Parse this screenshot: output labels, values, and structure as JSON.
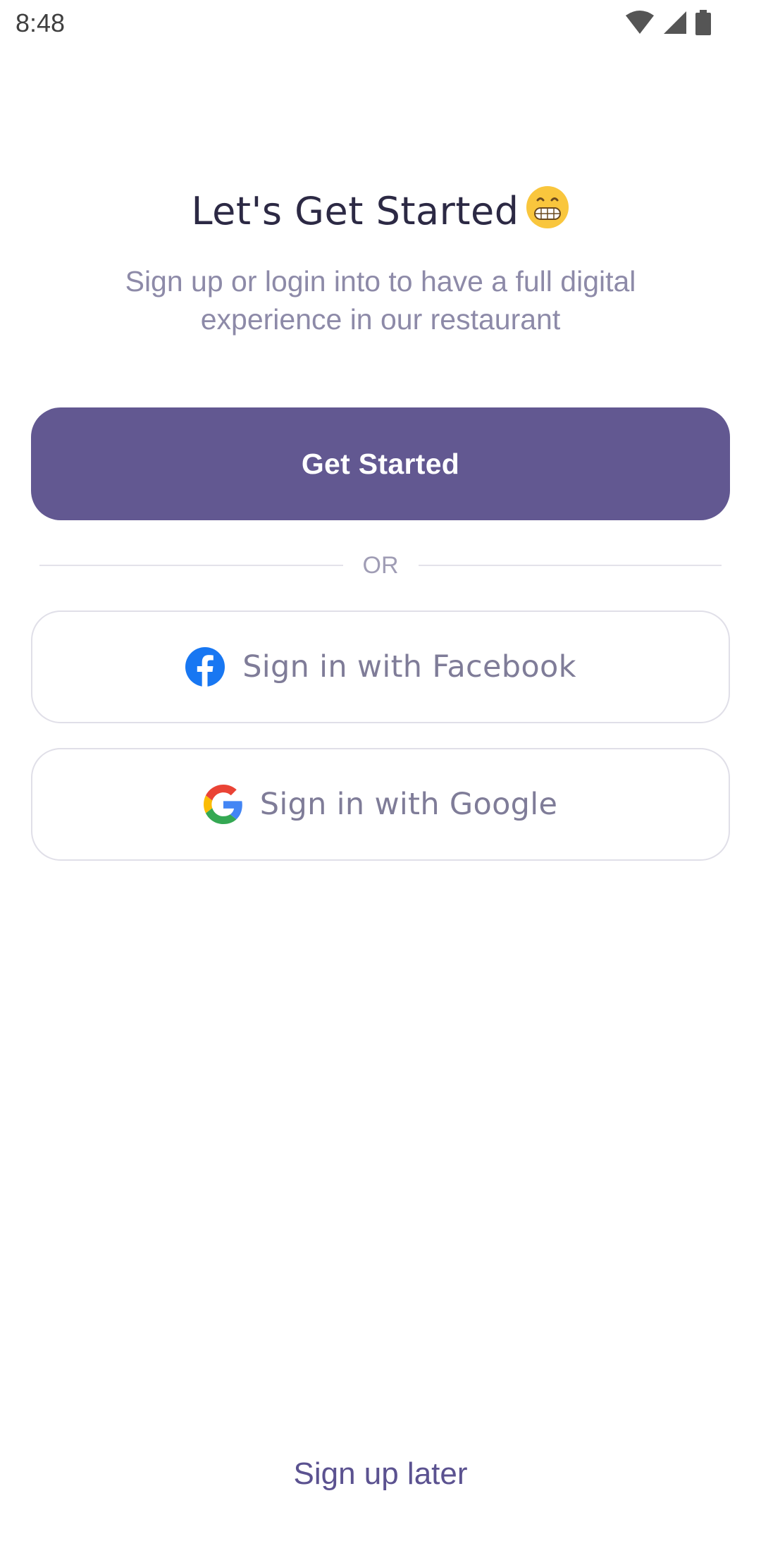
{
  "status_bar": {
    "time": "8:48",
    "icons": [
      "wifi-icon",
      "cellular-signal-icon",
      "battery-icon"
    ]
  },
  "header": {
    "title": "Let's Get Started",
    "title_emoji": "grinning-face-emoji",
    "subtitle": "Sign up or login into to have a full digital experience in our restaurant"
  },
  "actions": {
    "get_started_label": "Get Started",
    "divider_label": "OR",
    "facebook_label": "Sign in with Facebook",
    "facebook_icon": "facebook-icon",
    "google_label": "Sign in with Google",
    "google_icon": "google-icon",
    "later_label": "Sign up later"
  },
  "colors": {
    "primary": "#625891",
    "title_text": "#2c2944",
    "muted_text": "#8d8aa8",
    "facebook_blue": "#1877f2",
    "link_text": "#5b5290"
  }
}
